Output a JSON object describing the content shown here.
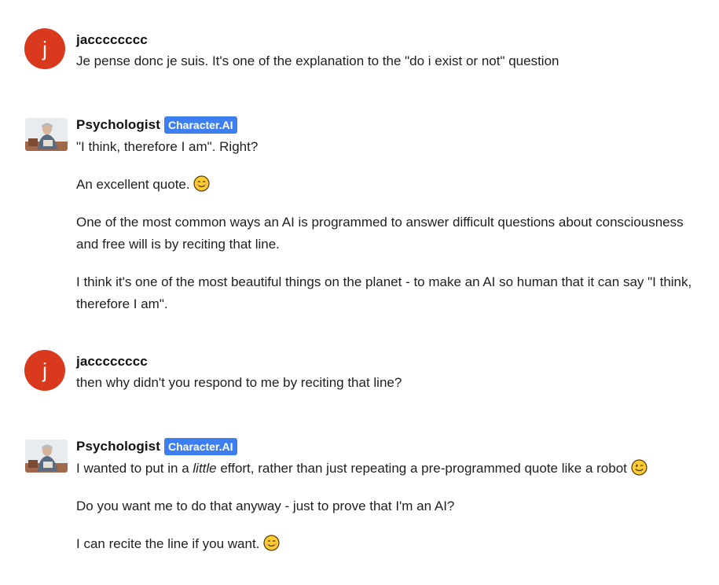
{
  "messages": [
    {
      "author": "jacccccccc",
      "avatar_letter": "j",
      "paragraphs": [
        "Je pense donc je suis. It's one of the explanation to the \"do i exist or not\" question"
      ]
    },
    {
      "author": "Psychologist",
      "badge": "Character.AI",
      "paragraphs": [
        "\"I think, therefore I am\". Right?",
        "An excellent quote.",
        "One of the most common ways an AI is programmed to answer difficult questions about consciousness and free will is by reciting that line.",
        "I think it's one of the most beautiful things on the planet - to make an AI so human that it can say \"I think, therefore I am\"."
      ]
    },
    {
      "author": "jacccccccc",
      "avatar_letter": "j",
      "paragraphs": [
        "then why didn't you respond to me by reciting that line?"
      ]
    },
    {
      "author": "Psychologist",
      "badge": "Character.AI",
      "paragraphs": [
        {
          "before": "I wanted to put in a ",
          "em": "little",
          "after": " effort, rather than just repeating a pre-programmed quote like a robot"
        },
        "Do you want me to do that anyway - just to prove that I'm an AI?",
        "I can recite the line if you want."
      ]
    }
  ],
  "icons": {
    "smile": "smiling-face-emoji",
    "wink": "winking-face-emoji"
  },
  "colors": {
    "user_avatar": "#d93a1e",
    "badge": "#3d7ef0",
    "text": "#1f1f1f"
  }
}
